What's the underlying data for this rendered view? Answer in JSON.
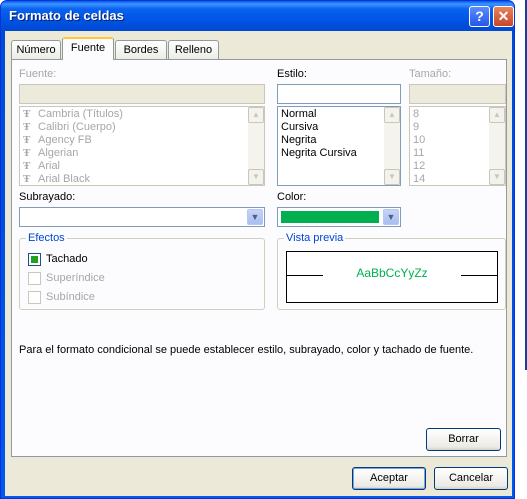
{
  "window": {
    "title": "Formato de celdas"
  },
  "titlebar": {
    "help_label": "?",
    "close_label": "✕"
  },
  "tabs": [
    {
      "label": "Número",
      "active": false
    },
    {
      "label": "Fuente",
      "active": true
    },
    {
      "label": "Bordes",
      "active": false
    },
    {
      "label": "Relleno",
      "active": false
    }
  ],
  "font": {
    "label": "Fuente:",
    "value": "",
    "items": [
      "Cambria (Títulos)",
      "Calibri (Cuerpo)",
      "Agency FB",
      "Algerian",
      "Arial",
      "Arial Black"
    ]
  },
  "style": {
    "label": "Estilo:",
    "value": "",
    "items": [
      "Normal",
      "Cursiva",
      "Negrita",
      "Negrita Cursiva"
    ]
  },
  "size": {
    "label": "Tamaño:",
    "value": "",
    "items": [
      "8",
      "9",
      "10",
      "11",
      "12",
      "14"
    ]
  },
  "underline": {
    "label": "Subrayado:",
    "value": ""
  },
  "color": {
    "label": "Color:",
    "swatch": "#00b050"
  },
  "effects": {
    "title": "Efectos",
    "strikethrough": {
      "label": "Tachado",
      "checked": true
    },
    "superscript": {
      "label": "Superíndice",
      "checked": false
    },
    "subscript": {
      "label": "Subíndice",
      "checked": false
    }
  },
  "preview": {
    "title": "Vista previa",
    "sample": "AaBbCcYyZz"
  },
  "info_text": "Para el formato condicional se puede establecer estilo, subrayado, color y tachado de fuente.",
  "buttons": {
    "clear": "Borrar",
    "ok": "Aceptar",
    "cancel": "Cancelar"
  },
  "icons": {
    "truetype": "truetype-font-icon",
    "dropdown": "chevron-down-icon"
  },
  "colors": {
    "accent": "#0046d5",
    "tab_highlight": "#ffc83c"
  }
}
